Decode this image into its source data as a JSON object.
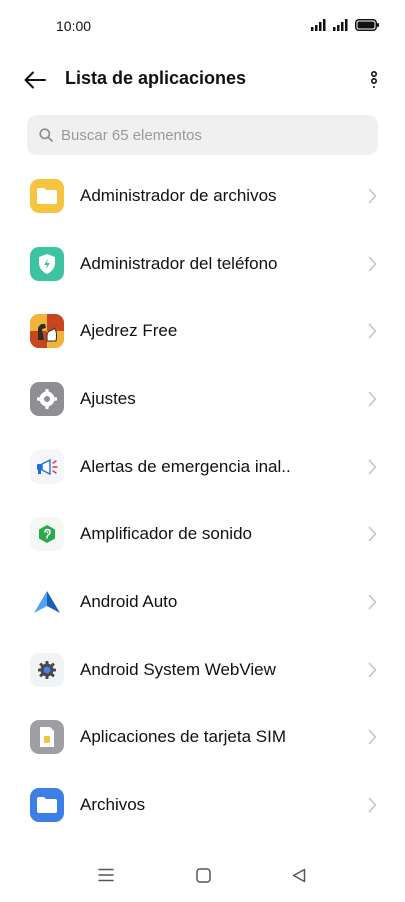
{
  "status_bar": {
    "time": "10:00"
  },
  "header": {
    "title": "Lista de aplicaciones"
  },
  "search": {
    "placeholder": "Buscar 65 elementos"
  },
  "apps": [
    {
      "label": "Administrador de archivos",
      "icon": "folder-icon",
      "color": "#F5C542"
    },
    {
      "label": "Administrador del teléfono",
      "icon": "shield-bolt-icon",
      "color": "#3CC3A1"
    },
    {
      "label": "Ajedrez Free",
      "icon": "chess-icon",
      "color": "#E8732A"
    },
    {
      "label": "Ajustes",
      "icon": "gear-icon",
      "color": "#8E8E93"
    },
    {
      "label": "Alertas de emergencia inal..",
      "icon": "megaphone-icon",
      "color": "#1E6FD9"
    },
    {
      "label": "Amplificador de sonido",
      "icon": "ear-icon",
      "color": "#2DA84E"
    },
    {
      "label": "Android Auto",
      "icon": "android-auto-icon",
      "color": "#2C8BE8"
    },
    {
      "label": "Android System WebView",
      "icon": "webview-gear-icon",
      "color": "#4A4A4A"
    },
    {
      "label": "Aplicaciones de tarjeta SIM",
      "icon": "sim-card-icon",
      "color": "#9E9EA3"
    },
    {
      "label": "Archivos",
      "icon": "files-folder-icon",
      "color": "#3D7FE6"
    }
  ]
}
